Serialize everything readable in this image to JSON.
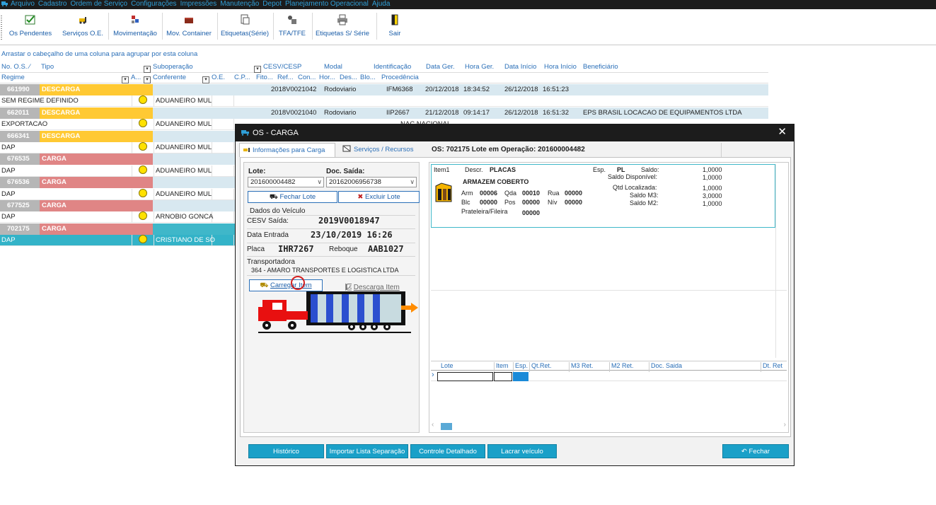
{
  "menu": {
    "items": [
      "Arquivo",
      "Cadastro",
      "Ordem de Serviço",
      "Configurações",
      "Impressões",
      "Manutenção",
      "Depot",
      "Planejamento Operacional",
      "Ajuda"
    ]
  },
  "toolbar": {
    "buttons": [
      "Os Pendentes",
      "Serviços O.E.",
      "Movimentação",
      "Mov. Container",
      "Etiquetas(Série)",
      "TFA/TFE",
      "Etiquetas S/ Série",
      "Sair"
    ]
  },
  "grid": {
    "group_hint": "Arrastar o cabeçalho de uma coluna para agrupar por esta coluna",
    "header1": [
      "No. O.S.",
      "Tipo",
      "Suboperação",
      "CESV/CESP",
      "Modal",
      "Identificação",
      "Data Ger.",
      "Hora Ger.",
      "Data Início",
      "Hora Início",
      "Beneficiário"
    ],
    "header2": [
      "Regime",
      "A...",
      "Conferente",
      "O.E.",
      "C.P...",
      "Fito...",
      "Ref...",
      "Con...",
      "Hor...",
      "Des...",
      "Blo...",
      "Procedência"
    ],
    "groups": [
      {
        "id": "661990",
        "tipo": "DESCARGA",
        "color": "#ffc933",
        "cesv": "2018V0021042",
        "modal": "Rodoviario",
        "ident": "IFM6368",
        "data_ger": "20/12/2018",
        "hora_ger": "18:34:52",
        "data_ini": "26/12/2018",
        "hora_ini": "16:51:23",
        "benef": "",
        "regime": "SEM REGIME DEFINIDO",
        "conferente": "ADUANEIRO MUL",
        "procedencia": ""
      },
      {
        "id": "662011",
        "tipo": "DESCARGA",
        "color": "#ffc933",
        "cesv": "2018V0021040",
        "modal": "Rodoviario",
        "ident": "IIP2667",
        "data_ger": "21/12/2018",
        "hora_ger": "09:14:17",
        "data_ini": "26/12/2018",
        "hora_ini": "16:51:32",
        "benef": "EPS BRASIL LOCACAO DE EQUIPAMENTOS LTDA",
        "regime": "EXPORTACAO",
        "conferente": "ADUANEIRO MUL",
        "procedencia": "NAC NACIONAL"
      },
      {
        "id": "666341",
        "tipo": "DESCARGA",
        "color": "#ffc933",
        "cesv": "",
        "modal": "",
        "ident": "",
        "data_ger": "",
        "hora_ger": "",
        "data_ini": "",
        "hora_ini": "",
        "benef": "",
        "regime": "DAP",
        "conferente": "ADUANEIRO MUL",
        "procedencia": ""
      },
      {
        "id": "676535",
        "tipo": "CARGA",
        "color": "#e08585",
        "cesv": "",
        "modal": "",
        "ident": "",
        "data_ger": "",
        "hora_ger": "",
        "data_ini": "",
        "hora_ini": "",
        "benef": "",
        "regime": "DAP",
        "conferente": "ADUANEIRO MUL",
        "procedencia": ""
      },
      {
        "id": "676536",
        "tipo": "CARGA",
        "color": "#e08585",
        "cesv": "",
        "modal": "",
        "ident": "",
        "data_ger": "",
        "hora_ger": "",
        "data_ini": "",
        "hora_ini": "",
        "benef": "",
        "regime": "DAP",
        "conferente": "ADUANEIRO MUL",
        "procedencia": ""
      },
      {
        "id": "677525",
        "tipo": "CARGA",
        "color": "#e08585",
        "cesv": "",
        "modal": "",
        "ident": "",
        "data_ger": "",
        "hora_ger": "",
        "data_ini": "",
        "hora_ini": "",
        "benef": "",
        "regime": "DAP",
        "conferente": "ARNOBIO GONCA",
        "procedencia": ""
      },
      {
        "id": "702175",
        "tipo": "CARGA",
        "color": "#e08585",
        "cesv": "",
        "modal": "",
        "ident": "",
        "data_ger": "",
        "hora_ger": "",
        "data_ini": "",
        "hora_ini": "",
        "benef": "",
        "regime": "DAP",
        "conferente": "CRISTIANO DE SO",
        "procedencia": "",
        "selected": true
      }
    ]
  },
  "dialog": {
    "title": "OS - CARGA",
    "tab_info": "Informações para Carga",
    "tab_services": "Serviços / Recursos",
    "os_label": "OS: 702175  Lote em Operação: 201600004482",
    "lote_label": "Lote:",
    "lote_value": "201600004482",
    "doc_label": "Doc. Saída:",
    "doc_value": "20162006956738",
    "btn_fechar_lote": "Fechar Lote",
    "btn_excluir_lote": "Excluir Lote",
    "dados_veiculo": "Dados do Veículo",
    "cesv_label": "CESV Saída:",
    "cesv_value": "2019V0018947",
    "entrada_label": "Data Entrada",
    "entrada_value": "23/10/2019 16:26",
    "placa_label": "Placa",
    "placa_value": "IHR7267",
    "reboque_label": "Reboque",
    "reboque_value": "AAB1027",
    "transp_label": "Transportadora",
    "transp_value": "364 - AMARO TRANSPORTES E LOGISTICA LTDA",
    "btn_carregar": "Carregar Item",
    "btn_descarga": "Descarga Item",
    "item": {
      "item_label": "Item1",
      "descr_label": "Descr.",
      "descr_value": "PLACAS",
      "esp_label": "Esp.",
      "esp_value": "PL",
      "armazem": "ARMAZEM COBERTO",
      "arm_label": "Arm",
      "arm_value": "00006",
      "qda_label": "Qda",
      "qda_value": "00010",
      "rua_label": "Rua",
      "rua_value": "00000",
      "blc_label": "Blc",
      "blc_value": "00000",
      "pos_label": "Pos",
      "pos_value": "00000",
      "niv_label": "Nív",
      "niv_value": "00000",
      "prat_label": "Prateleira/Fileira",
      "prat_value": "00000",
      "saldo_label": "Saldo:",
      "saldo_value": "1,0000",
      "saldo_disp_label": "Saldo Disponível:",
      "saldo_disp_value": "1,0000",
      "qtd_loc_label": "Qtd Localizada:",
      "qtd_loc_value": "1,0000",
      "saldo_m3_label": "Saldo M3:",
      "saldo_m3_value": "3,0000",
      "saldo_m2_label": "Saldo M2:",
      "saldo_m2_value": "1,0000"
    },
    "mini_grid_cols": [
      "Lote",
      "Item",
      "Esp.",
      "Qt.Ret.",
      "M3 Ret.",
      "M2 Ret.",
      "Doc. Saida",
      "Dt. Ret"
    ],
    "footer": {
      "historico": "Histórico",
      "importar": "Importar Lista Separação",
      "controle": "Controle Detalhado",
      "lacrar": "Lacrar veículo",
      "fechar": "Fechar"
    }
  },
  "colors": {
    "menubar": "#1c1c1c",
    "menu_text": "#2f9fd8",
    "descarga": "#ffc933",
    "carga": "#e08585",
    "selection": "#33b3c8",
    "footer_button": "#1aa0c8"
  }
}
